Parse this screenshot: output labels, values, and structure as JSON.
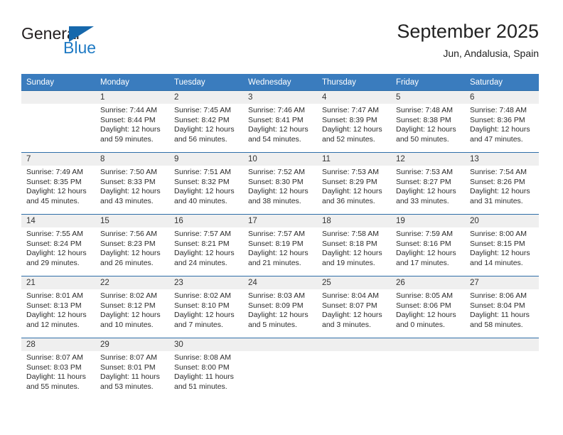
{
  "brand": {
    "name_part1": "General",
    "name_part2": "Blue",
    "accent_color": "#1f7ac4",
    "triangle_color": "#1668ac"
  },
  "header": {
    "title": "September 2025",
    "subtitle": "Jun, Andalusia, Spain"
  },
  "calendar": {
    "header_bg": "#3a7cbe",
    "daynum_band_bg": "#efefef",
    "row_divider_color": "#2f6ea8",
    "weekday_headers": [
      "Sunday",
      "Monday",
      "Tuesday",
      "Wednesday",
      "Thursday",
      "Friday",
      "Saturday"
    ],
    "weeks": [
      [
        {
          "day": "",
          "sunrise": "",
          "sunset": "",
          "daylight_line1": "",
          "daylight_line2": ""
        },
        {
          "day": "1",
          "sunrise": "Sunrise: 7:44 AM",
          "sunset": "Sunset: 8:44 PM",
          "daylight_line1": "Daylight: 12 hours",
          "daylight_line2": "and 59 minutes."
        },
        {
          "day": "2",
          "sunrise": "Sunrise: 7:45 AM",
          "sunset": "Sunset: 8:42 PM",
          "daylight_line1": "Daylight: 12 hours",
          "daylight_line2": "and 56 minutes."
        },
        {
          "day": "3",
          "sunrise": "Sunrise: 7:46 AM",
          "sunset": "Sunset: 8:41 PM",
          "daylight_line1": "Daylight: 12 hours",
          "daylight_line2": "and 54 minutes."
        },
        {
          "day": "4",
          "sunrise": "Sunrise: 7:47 AM",
          "sunset": "Sunset: 8:39 PM",
          "daylight_line1": "Daylight: 12 hours",
          "daylight_line2": "and 52 minutes."
        },
        {
          "day": "5",
          "sunrise": "Sunrise: 7:48 AM",
          "sunset": "Sunset: 8:38 PM",
          "daylight_line1": "Daylight: 12 hours",
          "daylight_line2": "and 50 minutes."
        },
        {
          "day": "6",
          "sunrise": "Sunrise: 7:48 AM",
          "sunset": "Sunset: 8:36 PM",
          "daylight_line1": "Daylight: 12 hours",
          "daylight_line2": "and 47 minutes."
        }
      ],
      [
        {
          "day": "7",
          "sunrise": "Sunrise: 7:49 AM",
          "sunset": "Sunset: 8:35 PM",
          "daylight_line1": "Daylight: 12 hours",
          "daylight_line2": "and 45 minutes."
        },
        {
          "day": "8",
          "sunrise": "Sunrise: 7:50 AM",
          "sunset": "Sunset: 8:33 PM",
          "daylight_line1": "Daylight: 12 hours",
          "daylight_line2": "and 43 minutes."
        },
        {
          "day": "9",
          "sunrise": "Sunrise: 7:51 AM",
          "sunset": "Sunset: 8:32 PM",
          "daylight_line1": "Daylight: 12 hours",
          "daylight_line2": "and 40 minutes."
        },
        {
          "day": "10",
          "sunrise": "Sunrise: 7:52 AM",
          "sunset": "Sunset: 8:30 PM",
          "daylight_line1": "Daylight: 12 hours",
          "daylight_line2": "and 38 minutes."
        },
        {
          "day": "11",
          "sunrise": "Sunrise: 7:53 AM",
          "sunset": "Sunset: 8:29 PM",
          "daylight_line1": "Daylight: 12 hours",
          "daylight_line2": "and 36 minutes."
        },
        {
          "day": "12",
          "sunrise": "Sunrise: 7:53 AM",
          "sunset": "Sunset: 8:27 PM",
          "daylight_line1": "Daylight: 12 hours",
          "daylight_line2": "and 33 minutes."
        },
        {
          "day": "13",
          "sunrise": "Sunrise: 7:54 AM",
          "sunset": "Sunset: 8:26 PM",
          "daylight_line1": "Daylight: 12 hours",
          "daylight_line2": "and 31 minutes."
        }
      ],
      [
        {
          "day": "14",
          "sunrise": "Sunrise: 7:55 AM",
          "sunset": "Sunset: 8:24 PM",
          "daylight_line1": "Daylight: 12 hours",
          "daylight_line2": "and 29 minutes."
        },
        {
          "day": "15",
          "sunrise": "Sunrise: 7:56 AM",
          "sunset": "Sunset: 8:23 PM",
          "daylight_line1": "Daylight: 12 hours",
          "daylight_line2": "and 26 minutes."
        },
        {
          "day": "16",
          "sunrise": "Sunrise: 7:57 AM",
          "sunset": "Sunset: 8:21 PM",
          "daylight_line1": "Daylight: 12 hours",
          "daylight_line2": "and 24 minutes."
        },
        {
          "day": "17",
          "sunrise": "Sunrise: 7:57 AM",
          "sunset": "Sunset: 8:19 PM",
          "daylight_line1": "Daylight: 12 hours",
          "daylight_line2": "and 21 minutes."
        },
        {
          "day": "18",
          "sunrise": "Sunrise: 7:58 AM",
          "sunset": "Sunset: 8:18 PM",
          "daylight_line1": "Daylight: 12 hours",
          "daylight_line2": "and 19 minutes."
        },
        {
          "day": "19",
          "sunrise": "Sunrise: 7:59 AM",
          "sunset": "Sunset: 8:16 PM",
          "daylight_line1": "Daylight: 12 hours",
          "daylight_line2": "and 17 minutes."
        },
        {
          "day": "20",
          "sunrise": "Sunrise: 8:00 AM",
          "sunset": "Sunset: 8:15 PM",
          "daylight_line1": "Daylight: 12 hours",
          "daylight_line2": "and 14 minutes."
        }
      ],
      [
        {
          "day": "21",
          "sunrise": "Sunrise: 8:01 AM",
          "sunset": "Sunset: 8:13 PM",
          "daylight_line1": "Daylight: 12 hours",
          "daylight_line2": "and 12 minutes."
        },
        {
          "day": "22",
          "sunrise": "Sunrise: 8:02 AM",
          "sunset": "Sunset: 8:12 PM",
          "daylight_line1": "Daylight: 12 hours",
          "daylight_line2": "and 10 minutes."
        },
        {
          "day": "23",
          "sunrise": "Sunrise: 8:02 AM",
          "sunset": "Sunset: 8:10 PM",
          "daylight_line1": "Daylight: 12 hours",
          "daylight_line2": "and 7 minutes."
        },
        {
          "day": "24",
          "sunrise": "Sunrise: 8:03 AM",
          "sunset": "Sunset: 8:09 PM",
          "daylight_line1": "Daylight: 12 hours",
          "daylight_line2": "and 5 minutes."
        },
        {
          "day": "25",
          "sunrise": "Sunrise: 8:04 AM",
          "sunset": "Sunset: 8:07 PM",
          "daylight_line1": "Daylight: 12 hours",
          "daylight_line2": "and 3 minutes."
        },
        {
          "day": "26",
          "sunrise": "Sunrise: 8:05 AM",
          "sunset": "Sunset: 8:06 PM",
          "daylight_line1": "Daylight: 12 hours",
          "daylight_line2": "and 0 minutes."
        },
        {
          "day": "27",
          "sunrise": "Sunrise: 8:06 AM",
          "sunset": "Sunset: 8:04 PM",
          "daylight_line1": "Daylight: 11 hours",
          "daylight_line2": "and 58 minutes."
        }
      ],
      [
        {
          "day": "28",
          "sunrise": "Sunrise: 8:07 AM",
          "sunset": "Sunset: 8:03 PM",
          "daylight_line1": "Daylight: 11 hours",
          "daylight_line2": "and 55 minutes."
        },
        {
          "day": "29",
          "sunrise": "Sunrise: 8:07 AM",
          "sunset": "Sunset: 8:01 PM",
          "daylight_line1": "Daylight: 11 hours",
          "daylight_line2": "and 53 minutes."
        },
        {
          "day": "30",
          "sunrise": "Sunrise: 8:08 AM",
          "sunset": "Sunset: 8:00 PM",
          "daylight_line1": "Daylight: 11 hours",
          "daylight_line2": "and 51 minutes."
        },
        {
          "day": "",
          "sunrise": "",
          "sunset": "",
          "daylight_line1": "",
          "daylight_line2": ""
        },
        {
          "day": "",
          "sunrise": "",
          "sunset": "",
          "daylight_line1": "",
          "daylight_line2": ""
        },
        {
          "day": "",
          "sunrise": "",
          "sunset": "",
          "daylight_line1": "",
          "daylight_line2": ""
        },
        {
          "day": "",
          "sunrise": "",
          "sunset": "",
          "daylight_line1": "",
          "daylight_line2": ""
        }
      ]
    ]
  }
}
